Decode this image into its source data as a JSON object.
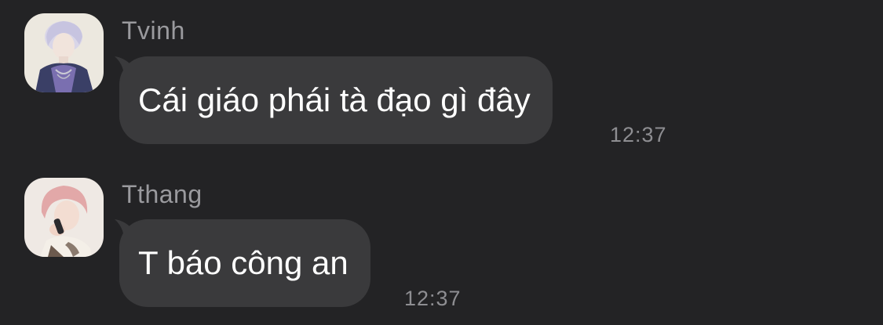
{
  "messages": [
    {
      "sender": "Tvinh",
      "text": "Cái giáo phái tà đạo gì đây",
      "time": "12:37"
    },
    {
      "sender": "Tthang",
      "text": "T báo công an",
      "time": "12:37"
    }
  ],
  "colors": {
    "background": "#232325",
    "bubble": "#3a3a3c",
    "sender_text": "#9a9a9e",
    "message_text": "#ffffff",
    "time_text": "#8e8e92"
  }
}
